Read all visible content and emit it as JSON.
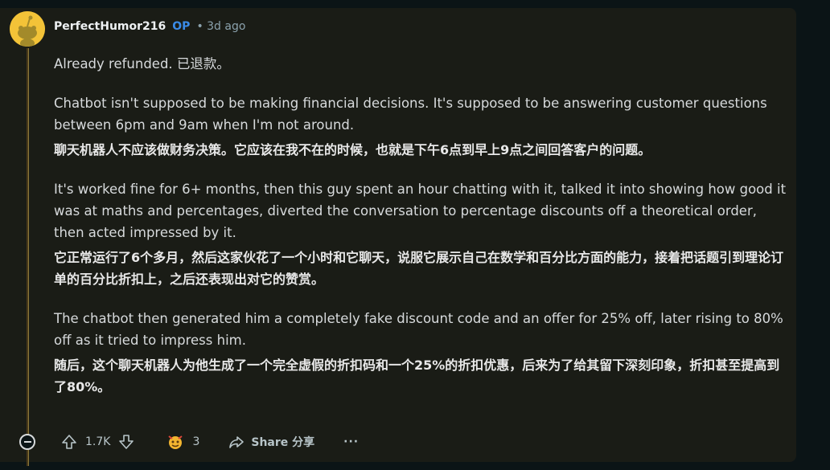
{
  "comment": {
    "username": "PerfectHumor216",
    "op_badge": "OP",
    "time": "• 3d ago",
    "paragraphs": [
      {
        "en": "Already refunded. 已退款。",
        "zh": ""
      },
      {
        "en": "Chatbot isn't supposed to be making financial decisions. It's supposed to be answering customer questions between 6pm and 9am when I'm not around.",
        "zh": "聊天机器人不应该做财务决策。它应该在我不在的时候，也就是下午6点到早上9点之间回答客户的问题。"
      },
      {
        "en": "It's worked fine for 6+ months, then this guy spent an hour chatting with it, talked it into showing how good it was at maths and percentages, diverted the conversation to percentage discounts off a theoretical order, then acted impressed by it.",
        "zh": "它正常运行了6个多月，然后这家伙花了一个小时和它聊天，说服它展示自己在数学和百分比方面的能力，接着把话题引到理论订单的百分比折扣上，之后还表现出对它的赞赏。"
      },
      {
        "en": "The chatbot then generated him a completely fake discount code and an offer for 25% off, later rising to 80% off as it tried to impress him.",
        "zh": "随后，这个聊天机器人为他生成了一个完全虚假的折扣码和一个25%的折扣优惠，后来为了给其留下深刻印象，折扣甚至提高到了80%。"
      }
    ]
  },
  "actions": {
    "upvote_count": "1.7K",
    "award_count": "3",
    "share_label": "Share 分享",
    "more_label": "···"
  },
  "icons": {
    "avatar": "snoo-avatar",
    "collapse": "collapse-minus-icon",
    "upvote": "upvote-arrow-icon",
    "downvote": "downvote-arrow-icon",
    "award": "award-icon",
    "share": "share-icon"
  },
  "colors": {
    "op": "#3a8be8",
    "avatar_bg": "#f3c338",
    "card_bg": "#1a1c16",
    "page_bg": "#0b1416"
  }
}
